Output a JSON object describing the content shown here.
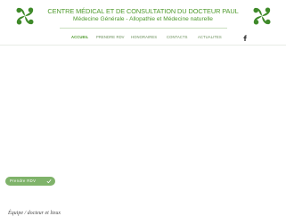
{
  "header": {
    "title": "CENTRE MÉDICAL ET DE CONSULTATION DU DOCTEUR PAUL",
    "subtitle": "Médecine Générale - Allopathie et Médecine naturelle"
  },
  "nav": {
    "items": [
      {
        "label": "ACCUEIL"
      },
      {
        "label": "PRENDRE RDV"
      },
      {
        "label": "HONORAIRES"
      },
      {
        "label": "CONTACTS"
      },
      {
        "label": "ACTUALITES"
      }
    ],
    "social_icon": "facebook-icon"
  },
  "cta": {
    "label": "Prendre RDV"
  },
  "content": {
    "heading": "Équipe / docteur et lieux"
  },
  "colors": {
    "brand_green": "#4e9a2c",
    "button_green": "#7fb36a"
  }
}
